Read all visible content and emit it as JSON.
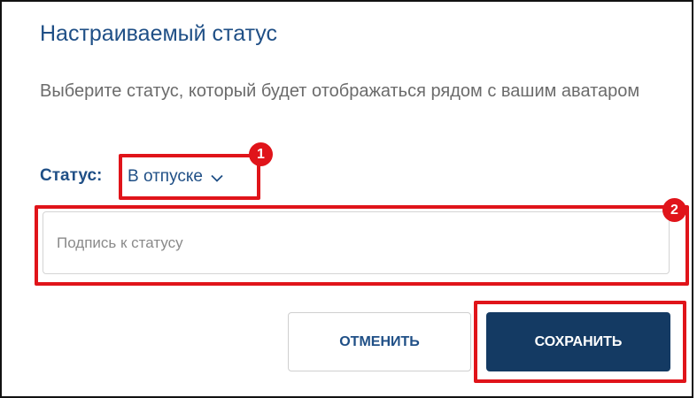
{
  "dialog": {
    "title": "Настраиваемый статус",
    "description": "Выберите статус, который будет отображаться рядом с вашим аватаром"
  },
  "status": {
    "label": "Статус:",
    "selected": "В отпуске",
    "icon": "chevron-down-icon"
  },
  "caption": {
    "value": "",
    "placeholder": "Подпись к статусу"
  },
  "actions": {
    "cancel_label": "ОТМЕНИТЬ",
    "save_label": "СОХРАНИТЬ"
  },
  "annotations": {
    "badge_1": "1",
    "badge_2": "2"
  },
  "colors": {
    "accent": "#1f4f86",
    "primary_button": "#143a63",
    "annotation_red": "#e0141a"
  }
}
